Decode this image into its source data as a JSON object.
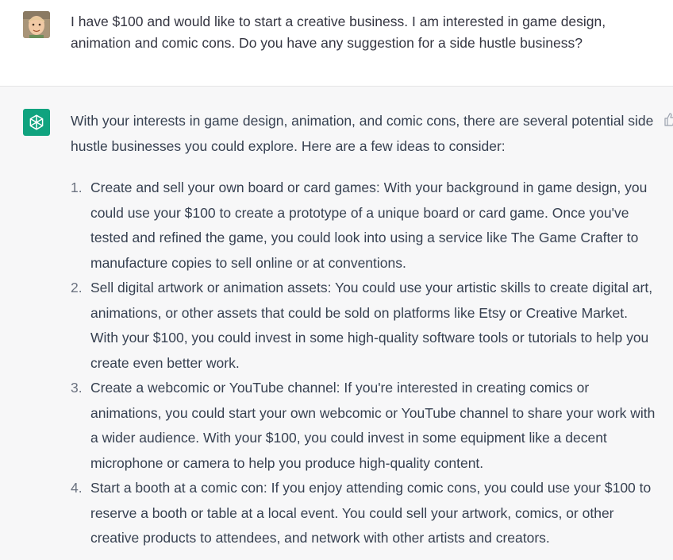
{
  "user_message": {
    "avatar_icon": "user-avatar-illustration",
    "text": "I have $100 and would like to start a creative business. I am interested in game design, animation and comic cons. Do you have any suggestion for a side hustle business?"
  },
  "assistant_message": {
    "avatar_icon": "openai-logo-icon",
    "avatar_color": "#10a37f",
    "feedback_icon": "thumbs-up-icon",
    "intro": "With your interests in game design, animation, and comic cons, there are several potential side hustle businesses you could explore. Here are a few ideas to consider:",
    "items": [
      {
        "number": "1.",
        "text": "Create and sell your own board or card games: With your background in game design, you could use your $100 to create a prototype of a unique board or card game. Once you've tested and refined the game, you could look into using a service like The Game Crafter to manufacture copies to sell online or at conventions."
      },
      {
        "number": "2.",
        "text": "Sell digital artwork or animation assets: You could use your artistic skills to create digital art, animations, or other assets that could be sold on platforms like Etsy or Creative Market. With your $100, you could invest in some high-quality software tools or tutorials to help you create even better work."
      },
      {
        "number": "3.",
        "text": "Create a webcomic or YouTube channel: If you're interested in creating comics or animations, you could start your own webcomic or YouTube channel to share your work with a wider audience. With your $100, you could invest in some equipment like a decent microphone or camera to help you produce high-quality content."
      },
      {
        "number": "4.",
        "text": "Start a booth at a comic con: If you enjoy attending comic cons, you could use your $100 to reserve a booth or table at a local event. You could sell your artwork, comics, or other creative products to attendees, and network with other artists and creators."
      }
    ]
  }
}
